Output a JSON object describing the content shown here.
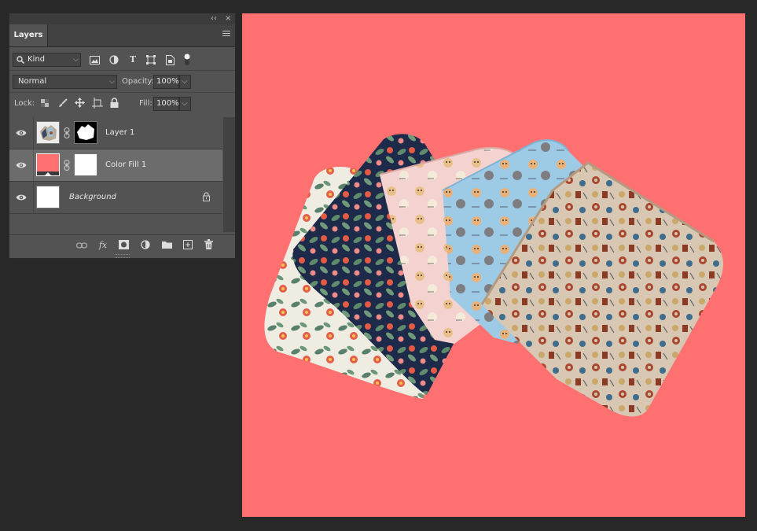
{
  "panel": {
    "tab_label": "Layers",
    "collapse_glyph": "‹‹",
    "close_glyph": "×",
    "filter": {
      "label": "Kind",
      "search_icon": "search-icon"
    },
    "blend_mode": "Normal",
    "opacity_label": "Opacity:",
    "opacity_value": "100%",
    "lock_label": "Lock:",
    "fill_label": "Fill:",
    "fill_value": "100%"
  },
  "layers": [
    {
      "name": "Layer 1",
      "visible": true,
      "selected": false,
      "italic": false
    },
    {
      "name": "Color Fill 1",
      "visible": true,
      "selected": true,
      "italic": false,
      "fill_color": "#ff7070"
    },
    {
      "name": "Background",
      "visible": true,
      "selected": false,
      "italic": true,
      "locked": true
    }
  ],
  "canvas": {
    "background_color": "#ff7070",
    "photo": "fabric-pouches-photo"
  },
  "colors": {
    "app_bg": "#282828",
    "panel_bg": "#535353",
    "selected_row": "#6c6c6c",
    "fill_color": "#ff7070"
  }
}
